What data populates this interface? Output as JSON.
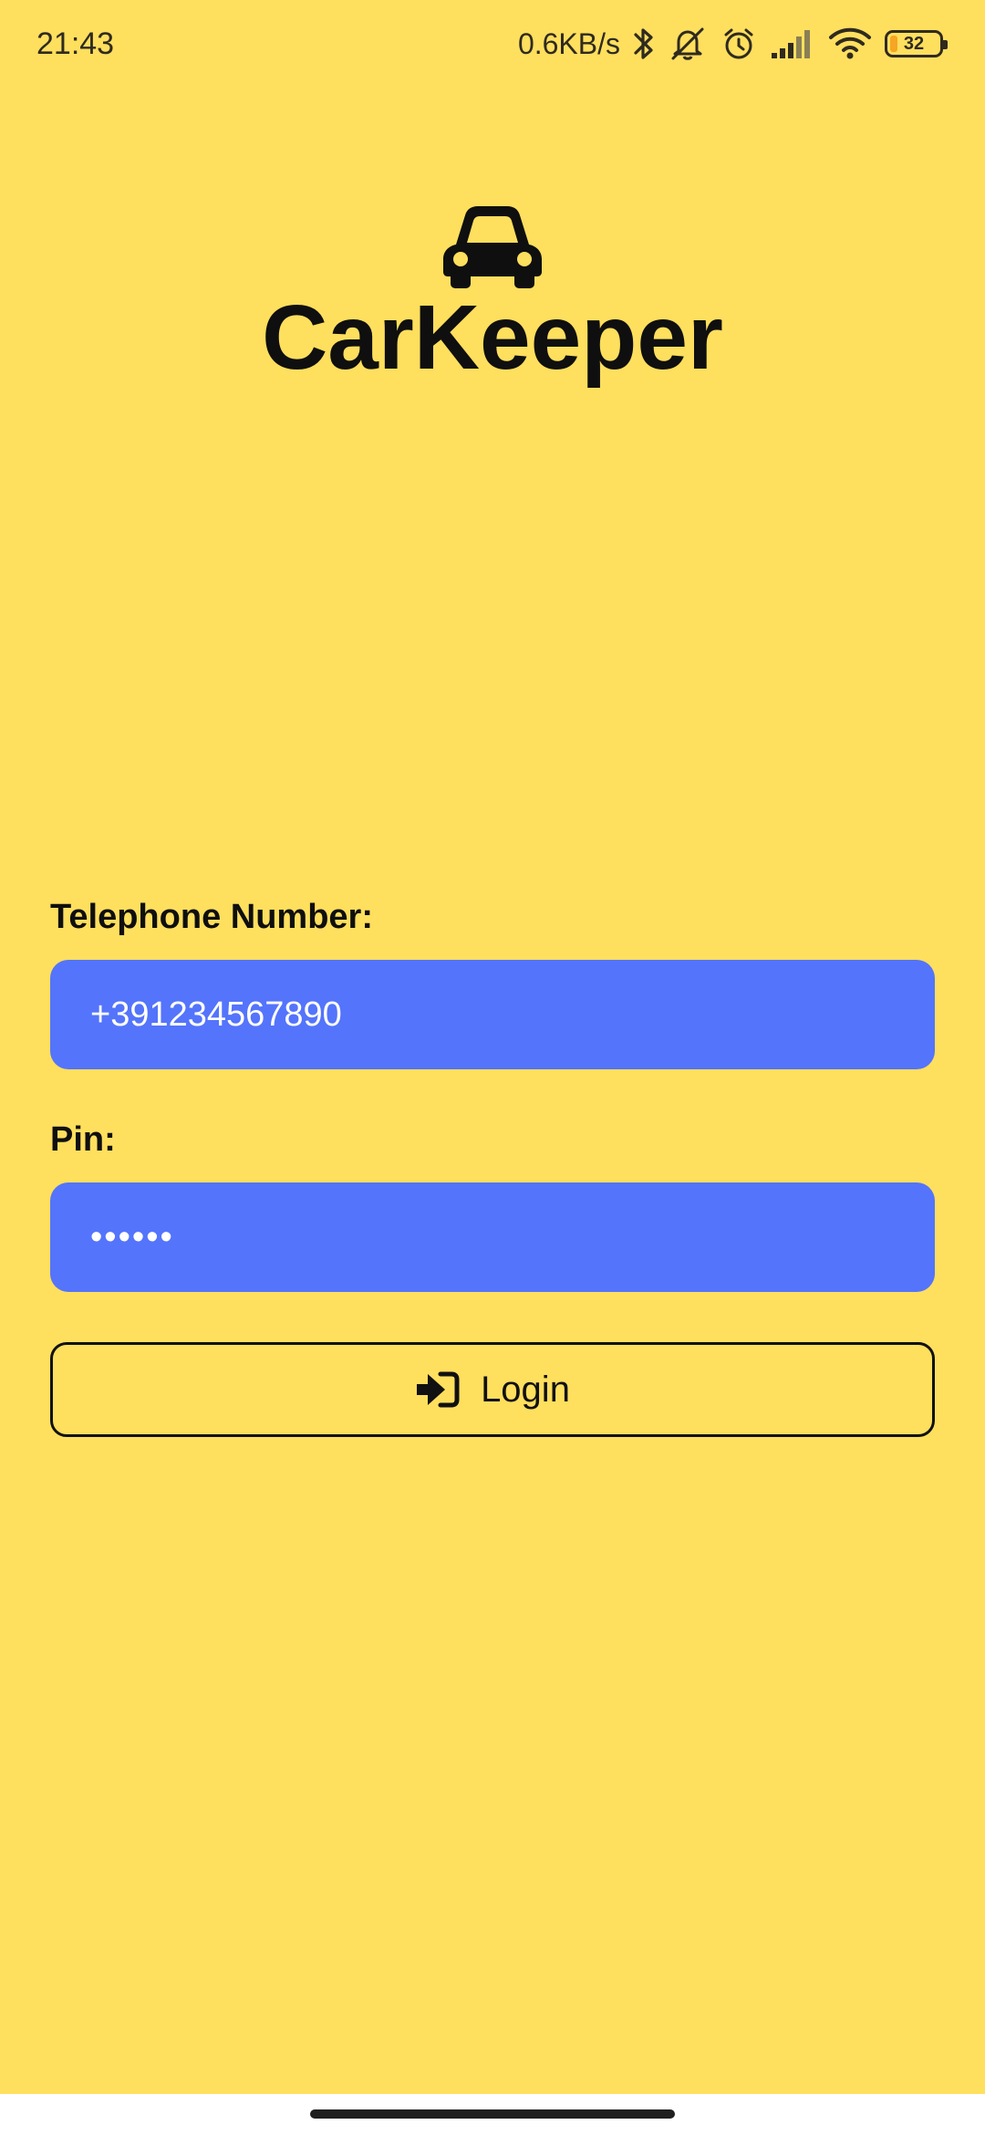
{
  "status_bar": {
    "time": "21:43",
    "net_speed": "0.6KB/s",
    "icons": [
      "bluetooth-icon",
      "mute-icon",
      "alarm-icon",
      "signal-icon",
      "wifi-icon"
    ],
    "battery_level": "32"
  },
  "app": {
    "logo_icon": "car-icon",
    "title": "CarKeeper"
  },
  "form": {
    "phone_label": "Telephone Number:",
    "phone_value": "+391234567890",
    "pin_label": "Pin:",
    "pin_value": "••••••",
    "login_label": "Login",
    "login_icon": "sign-in-icon"
  },
  "colors": {
    "background": "#FFDF5E",
    "input_background": "#5474FB",
    "text": "#0F0F0F",
    "input_text": "#FFFFFF"
  }
}
